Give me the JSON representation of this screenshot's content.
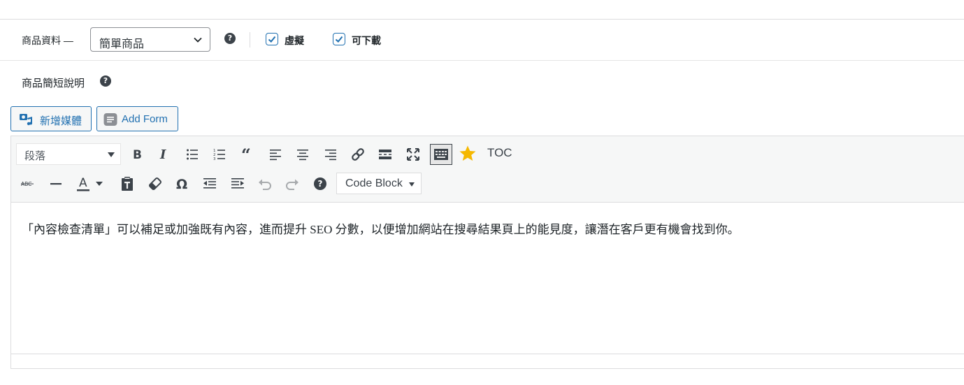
{
  "product_data": {
    "label": "商品資料 —",
    "type_select": {
      "value": "簡單商品"
    },
    "checkboxes": [
      {
        "label": "虛擬",
        "checked": true
      },
      {
        "label": "可下載",
        "checked": true
      }
    ]
  },
  "short_description": {
    "title": "商品簡短說明",
    "media_buttons": [
      {
        "label": "新增媒體",
        "icon": "add-media-icon"
      },
      {
        "label": "Add Form",
        "icon": "form-icon"
      }
    ],
    "toolbar": {
      "format_select": {
        "value": "段落"
      },
      "row1_icons": [
        "bold-icon",
        "italic-icon",
        "bulleted-list-icon",
        "numbered-list-icon",
        "blockquote-icon",
        "align-left-icon",
        "align-center-icon",
        "align-right-icon",
        "link-icon",
        "read-more-icon",
        "fullscreen-icon",
        "toolbar-toggle-icon",
        "star-icon"
      ],
      "toc_label": "TOC",
      "row2_icons": [
        "strikethrough-icon",
        "horizontal-line-icon",
        "text-color-icon",
        "paste-text-icon",
        "clear-formatting-icon",
        "special-character-icon",
        "outdent-icon",
        "indent-icon",
        "undo-icon",
        "redo-icon",
        "help-icon"
      ],
      "code_block_select": {
        "value": "Code Block"
      }
    },
    "content_text": "「內容檢查清單」可以補足或加強既有內容，進而提升 SEO 分數，以便增加網站在搜尋結果頁上的能見度，讓潛在客戶更有機會找到你。"
  },
  "colors": {
    "accent": "#2271b1",
    "text": "#1d2327",
    "toolbar_bg": "#f6f7f7",
    "border": "#dcdcde",
    "star": "#f5b800"
  }
}
